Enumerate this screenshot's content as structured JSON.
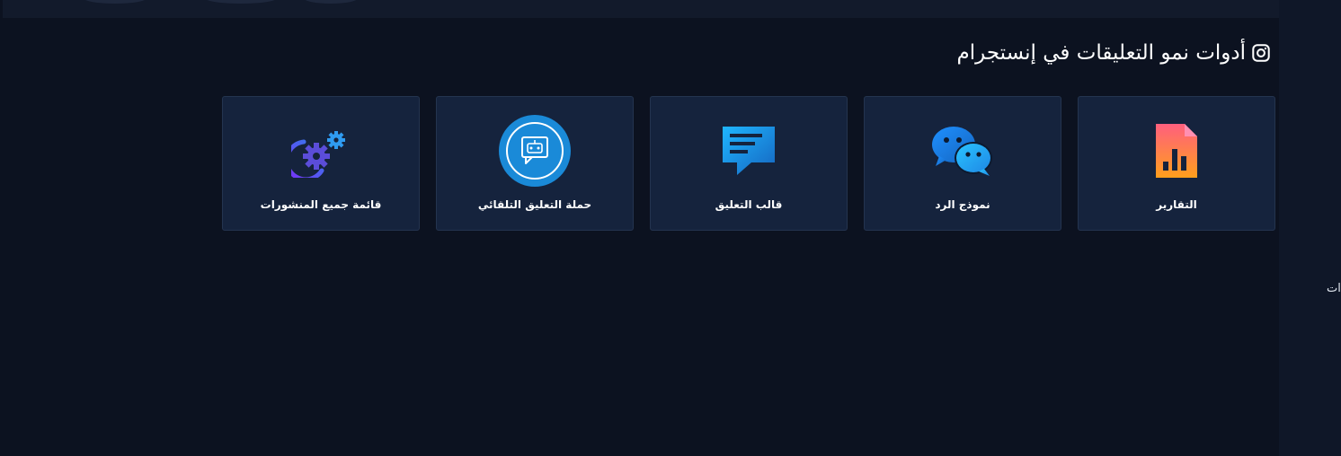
{
  "header": {
    "title": "أدوات نمو التعليقات في إنستجرام",
    "icon": "instagram-icon"
  },
  "cards": [
    {
      "label": "قائمة جميع المنشورات",
      "icon": "gears-icon"
    },
    {
      "label": "حملة التعليق التلقائي",
      "icon": "robot-chat-icon"
    },
    {
      "label": "قالب التعليق",
      "icon": "comment-template-icon"
    },
    {
      "label": "نموذج الرد",
      "icon": "chat-bubbles-icon"
    },
    {
      "label": "التقارير",
      "icon": "report-icon"
    }
  ],
  "right_panel": {
    "cut_text": "ات"
  },
  "colors": {
    "background": "#0c1220",
    "card": "#15233d",
    "card_border": "#24344f",
    "accent_blue": "#1a8ad8"
  }
}
